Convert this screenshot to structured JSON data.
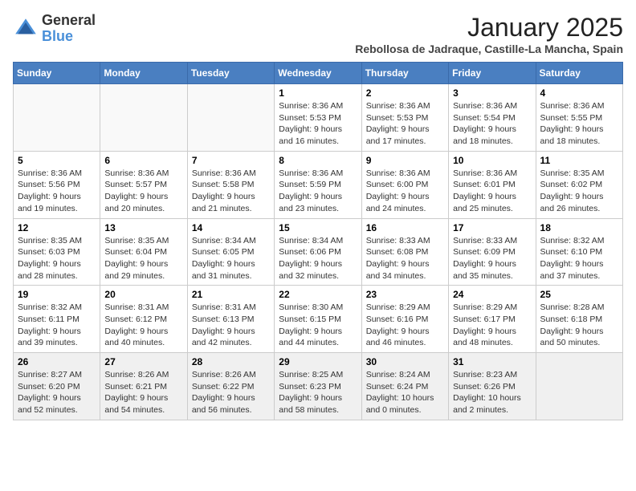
{
  "header": {
    "logo_general": "General",
    "logo_blue": "Blue",
    "title": "January 2025",
    "subtitle": "Rebollosa de Jadraque, Castille-La Mancha, Spain"
  },
  "days_of_week": [
    "Sunday",
    "Monday",
    "Tuesday",
    "Wednesday",
    "Thursday",
    "Friday",
    "Saturday"
  ],
  "weeks": [
    [
      {
        "day": "",
        "info": ""
      },
      {
        "day": "",
        "info": ""
      },
      {
        "day": "",
        "info": ""
      },
      {
        "day": "1",
        "info": "Sunrise: 8:36 AM\nSunset: 5:53 PM\nDaylight: 9 hours\nand 16 minutes."
      },
      {
        "day": "2",
        "info": "Sunrise: 8:36 AM\nSunset: 5:53 PM\nDaylight: 9 hours\nand 17 minutes."
      },
      {
        "day": "3",
        "info": "Sunrise: 8:36 AM\nSunset: 5:54 PM\nDaylight: 9 hours\nand 18 minutes."
      },
      {
        "day": "4",
        "info": "Sunrise: 8:36 AM\nSunset: 5:55 PM\nDaylight: 9 hours\nand 18 minutes."
      }
    ],
    [
      {
        "day": "5",
        "info": "Sunrise: 8:36 AM\nSunset: 5:56 PM\nDaylight: 9 hours\nand 19 minutes."
      },
      {
        "day": "6",
        "info": "Sunrise: 8:36 AM\nSunset: 5:57 PM\nDaylight: 9 hours\nand 20 minutes."
      },
      {
        "day": "7",
        "info": "Sunrise: 8:36 AM\nSunset: 5:58 PM\nDaylight: 9 hours\nand 21 minutes."
      },
      {
        "day": "8",
        "info": "Sunrise: 8:36 AM\nSunset: 5:59 PM\nDaylight: 9 hours\nand 23 minutes."
      },
      {
        "day": "9",
        "info": "Sunrise: 8:36 AM\nSunset: 6:00 PM\nDaylight: 9 hours\nand 24 minutes."
      },
      {
        "day": "10",
        "info": "Sunrise: 8:36 AM\nSunset: 6:01 PM\nDaylight: 9 hours\nand 25 minutes."
      },
      {
        "day": "11",
        "info": "Sunrise: 8:35 AM\nSunset: 6:02 PM\nDaylight: 9 hours\nand 26 minutes."
      }
    ],
    [
      {
        "day": "12",
        "info": "Sunrise: 8:35 AM\nSunset: 6:03 PM\nDaylight: 9 hours\nand 28 minutes."
      },
      {
        "day": "13",
        "info": "Sunrise: 8:35 AM\nSunset: 6:04 PM\nDaylight: 9 hours\nand 29 minutes."
      },
      {
        "day": "14",
        "info": "Sunrise: 8:34 AM\nSunset: 6:05 PM\nDaylight: 9 hours\nand 31 minutes."
      },
      {
        "day": "15",
        "info": "Sunrise: 8:34 AM\nSunset: 6:06 PM\nDaylight: 9 hours\nand 32 minutes."
      },
      {
        "day": "16",
        "info": "Sunrise: 8:33 AM\nSunset: 6:08 PM\nDaylight: 9 hours\nand 34 minutes."
      },
      {
        "day": "17",
        "info": "Sunrise: 8:33 AM\nSunset: 6:09 PM\nDaylight: 9 hours\nand 35 minutes."
      },
      {
        "day": "18",
        "info": "Sunrise: 8:32 AM\nSunset: 6:10 PM\nDaylight: 9 hours\nand 37 minutes."
      }
    ],
    [
      {
        "day": "19",
        "info": "Sunrise: 8:32 AM\nSunset: 6:11 PM\nDaylight: 9 hours\nand 39 minutes."
      },
      {
        "day": "20",
        "info": "Sunrise: 8:31 AM\nSunset: 6:12 PM\nDaylight: 9 hours\nand 40 minutes."
      },
      {
        "day": "21",
        "info": "Sunrise: 8:31 AM\nSunset: 6:13 PM\nDaylight: 9 hours\nand 42 minutes."
      },
      {
        "day": "22",
        "info": "Sunrise: 8:30 AM\nSunset: 6:15 PM\nDaylight: 9 hours\nand 44 minutes."
      },
      {
        "day": "23",
        "info": "Sunrise: 8:29 AM\nSunset: 6:16 PM\nDaylight: 9 hours\nand 46 minutes."
      },
      {
        "day": "24",
        "info": "Sunrise: 8:29 AM\nSunset: 6:17 PM\nDaylight: 9 hours\nand 48 minutes."
      },
      {
        "day": "25",
        "info": "Sunrise: 8:28 AM\nSunset: 6:18 PM\nDaylight: 9 hours\nand 50 minutes."
      }
    ],
    [
      {
        "day": "26",
        "info": "Sunrise: 8:27 AM\nSunset: 6:20 PM\nDaylight: 9 hours\nand 52 minutes."
      },
      {
        "day": "27",
        "info": "Sunrise: 8:26 AM\nSunset: 6:21 PM\nDaylight: 9 hours\nand 54 minutes."
      },
      {
        "day": "28",
        "info": "Sunrise: 8:26 AM\nSunset: 6:22 PM\nDaylight: 9 hours\nand 56 minutes."
      },
      {
        "day": "29",
        "info": "Sunrise: 8:25 AM\nSunset: 6:23 PM\nDaylight: 9 hours\nand 58 minutes."
      },
      {
        "day": "30",
        "info": "Sunrise: 8:24 AM\nSunset: 6:24 PM\nDaylight: 10 hours\nand 0 minutes."
      },
      {
        "day": "31",
        "info": "Sunrise: 8:23 AM\nSunset: 6:26 PM\nDaylight: 10 hours\nand 2 minutes."
      },
      {
        "day": "",
        "info": ""
      }
    ]
  ]
}
